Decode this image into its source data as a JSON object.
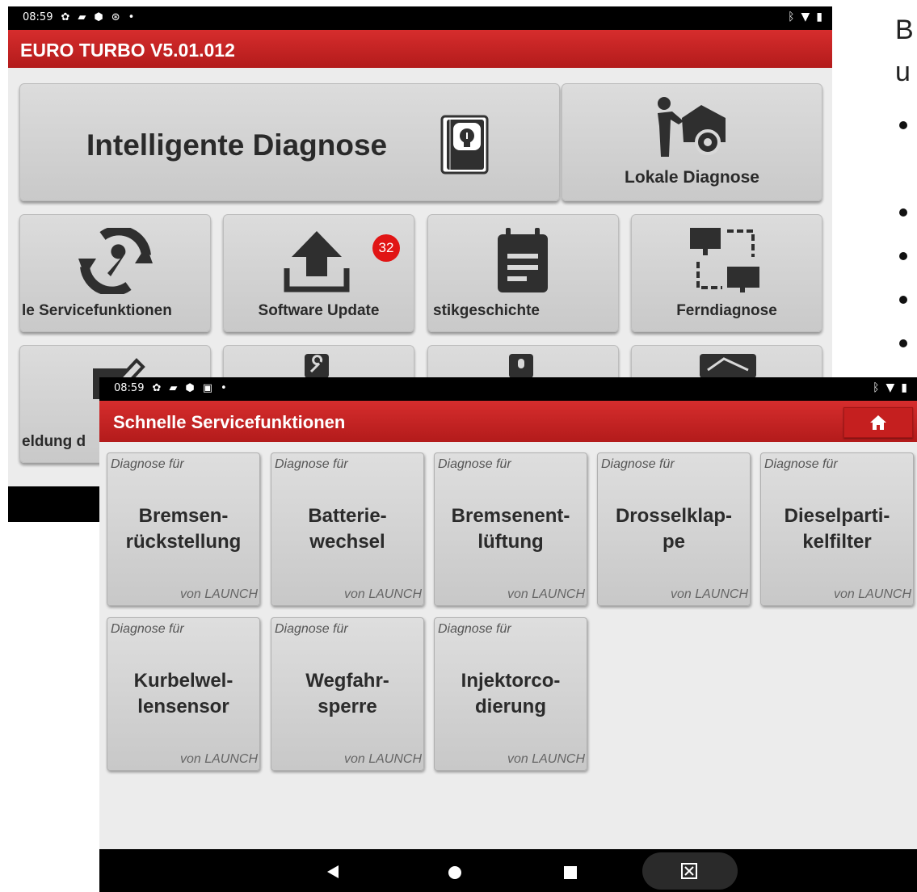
{
  "main_screen": {
    "status_time": "08:59",
    "title": "EURO TURBO V5.01.012",
    "big_tiles": [
      {
        "label": "Intelligente Diagnose",
        "icon": "lightbulb-book-icon"
      },
      {
        "label": "Lokale Diagnose",
        "icon": "mechanic-car-icon"
      }
    ],
    "tiles": [
      {
        "label": "le Servicefunktionen",
        "icon": "wrench-refresh-icon"
      },
      {
        "label": "Software Update",
        "icon": "upload-icon",
        "badge": "32"
      },
      {
        "label": "stikgeschichte",
        "icon": "clipboard-icon"
      },
      {
        "label": "Ferndiagnose",
        "icon": "remote-monitors-icon"
      }
    ],
    "partial_tile_label": "eldung d"
  },
  "side_text": {
    "line1": "B",
    "line2": "u"
  },
  "service_screen": {
    "status_time": "08:59",
    "title": "Schnelle Servicefunktionen",
    "home_icon": "home-icon",
    "services": [
      {
        "top": "Diagnose für",
        "name": "Bremsen-\nrückstellung",
        "bottom": "von LAUNCH"
      },
      {
        "top": "Diagnose für",
        "name": "Batterie-\nwechsel",
        "bottom": "von LAUNCH"
      },
      {
        "top": "Diagnose für",
        "name": "Bremsenent-\nlüftung",
        "bottom": "von LAUNCH"
      },
      {
        "top": "Diagnose für",
        "name": "Drosselklap-\npe",
        "bottom": "von LAUNCH"
      },
      {
        "top": "Diagnose für",
        "name": "Dieselparti-\nkelfilter",
        "bottom": "von LAUNCH"
      },
      {
        "top": "Diagnose für",
        "name": "Kurbelwel-\nlensensor",
        "bottom": "von LAUNCH"
      },
      {
        "top": "Diagnose für",
        "name": "Wegfahr-\nsperre",
        "bottom": "von LAUNCH"
      },
      {
        "top": "Diagnose für",
        "name": "Injektorco-\ndierung",
        "bottom": "von LAUNCH"
      }
    ]
  },
  "colors": {
    "title_red": "#c41f1f",
    "tile_gray": "#d2d2d2",
    "badge_red": "#e11515"
  }
}
